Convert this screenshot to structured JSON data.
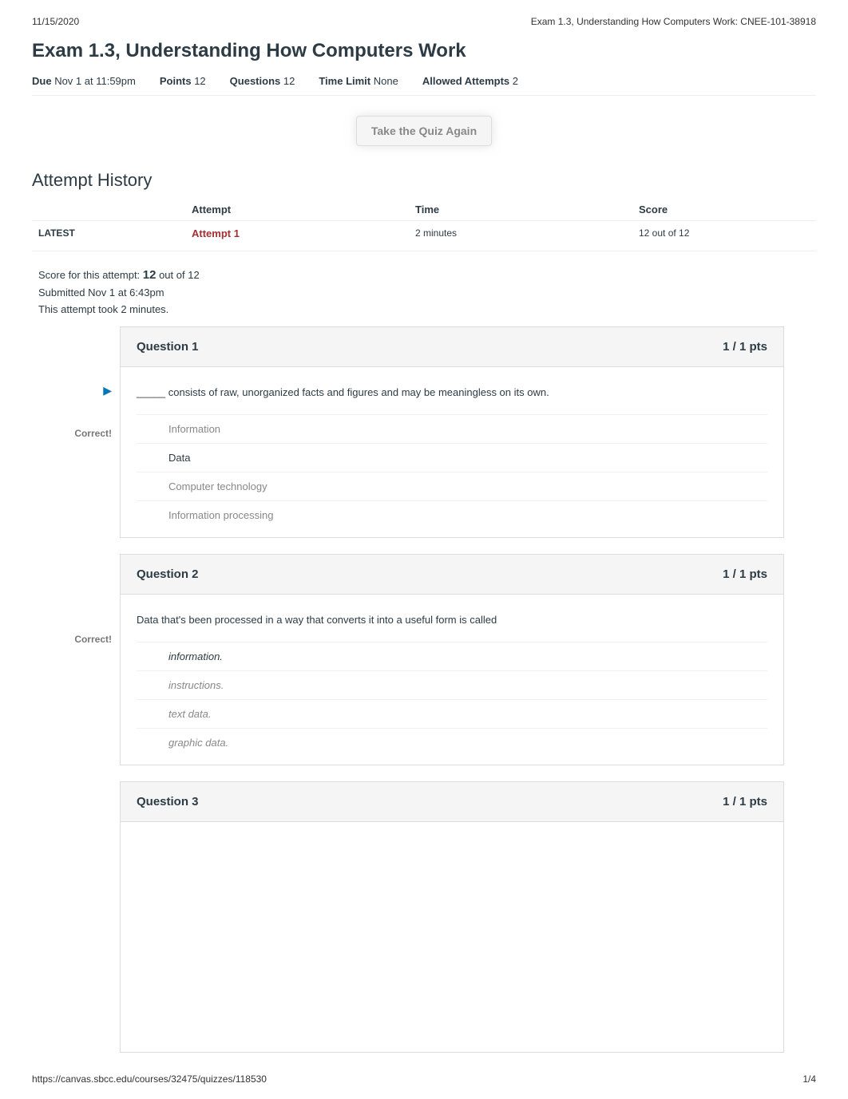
{
  "header": {
    "date": "11/15/2020",
    "title": "Exam 1.3, Understanding How Computers Work: CNEE-101-38918"
  },
  "quiz": {
    "title": "Exam 1.3, Understanding How Computers Work",
    "due_label": "Due",
    "due_value": "Nov 1 at 11:59pm",
    "points_label": "Points",
    "points_value": "12",
    "questions_label": "Questions",
    "questions_value": "12",
    "timelimit_label": "Time Limit",
    "timelimit_value": "None",
    "attempts_label": "Allowed Attempts",
    "attempts_value": "2",
    "take_again_btn": "Take the Quiz Again"
  },
  "history": {
    "section_title": "Attempt History",
    "headers": {
      "attempt": "Attempt",
      "time": "Time",
      "score": "Score"
    },
    "row": {
      "latest": "LATEST",
      "attempt": "Attempt 1",
      "time": "2 minutes",
      "score": "12 out of 12"
    }
  },
  "summary": {
    "score_prefix": "Score for this attempt: ",
    "score_value": "12",
    "score_suffix": " out of 12",
    "submitted": "Submitted Nov 1 at 6:43pm",
    "took": "This attempt took 2 minutes."
  },
  "labels": {
    "correct": "Correct!"
  },
  "questions": [
    {
      "title": "Question 1",
      "pts": "1 / 1 pts",
      "text": "_____ consists of raw, unorganized facts and figures and may be meaningless on its own.",
      "show_arrow": true,
      "answers": [
        {
          "text": "Information",
          "correct": false
        },
        {
          "text": "Data",
          "correct": true
        },
        {
          "text": "Computer technology",
          "correct": false
        },
        {
          "text": "Information processing",
          "correct": false
        }
      ]
    },
    {
      "title": "Question 2",
      "pts": "1 / 1 pts",
      "text": "Data that's been processed in a way that converts it into a useful form is called",
      "italic_answers": true,
      "answers": [
        {
          "text": "information.",
          "correct": true
        },
        {
          "text": "instructions.",
          "correct": false
        },
        {
          "text": "text data.",
          "correct": false
        },
        {
          "text": "graphic data.",
          "correct": false
        }
      ]
    },
    {
      "title": "Question 3",
      "pts": "1 / 1 pts",
      "text": "",
      "answers": []
    }
  ],
  "footer": {
    "url": "https://canvas.sbcc.edu/courses/32475/quizzes/118530",
    "page": "1/4"
  }
}
